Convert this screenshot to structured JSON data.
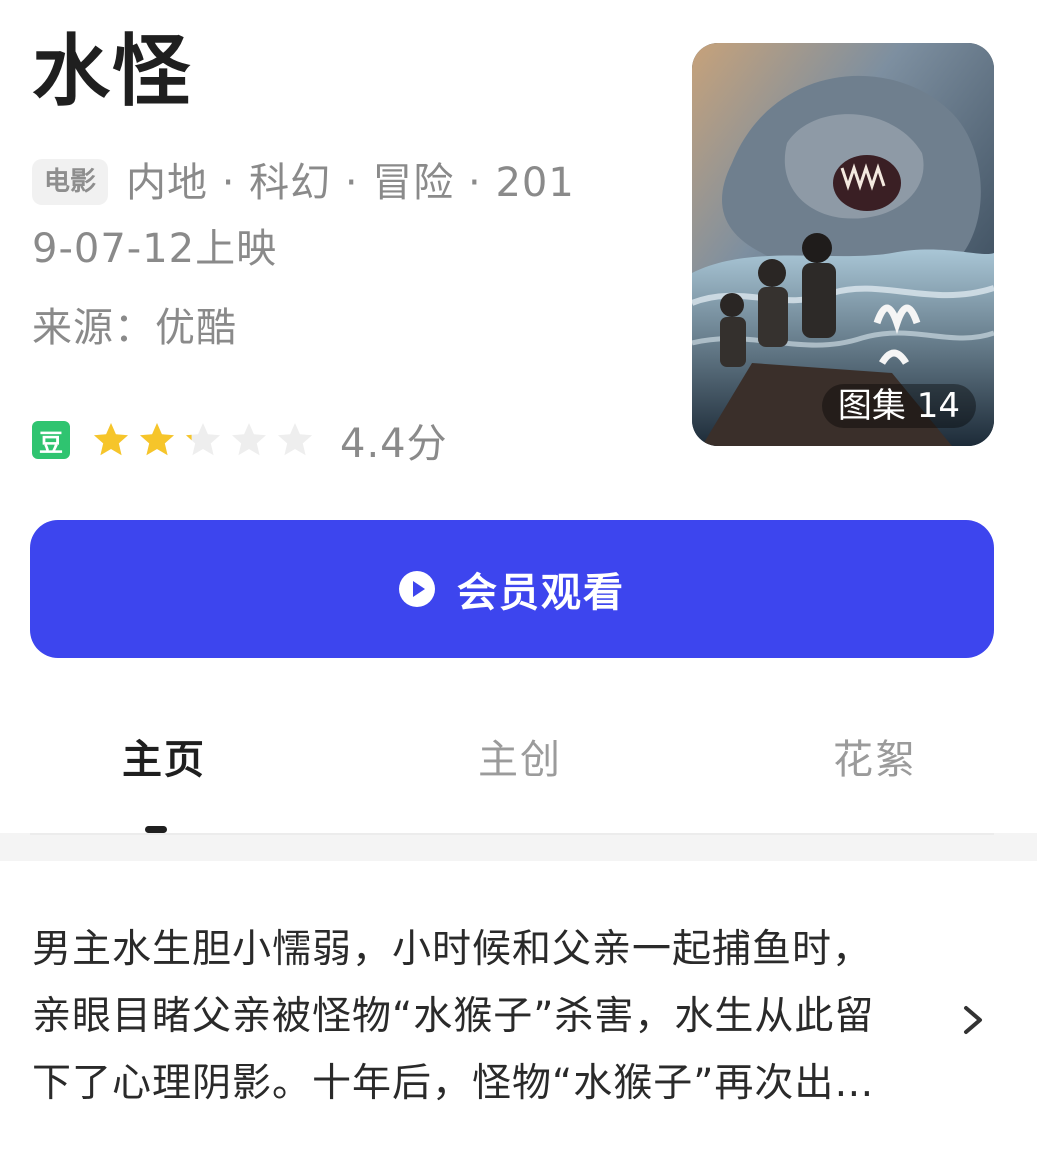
{
  "title": "水怪",
  "meta": {
    "type_badge": "电影",
    "line1": "内地 · 科幻 · 冒险 · 201",
    "line2": "9-07-12上映"
  },
  "source": "来源：优酷",
  "rating": {
    "platform_icon": "豆",
    "stars_total": 5,
    "stars_filled": 2.2,
    "score_text": "4.4分",
    "star_color": "#f6c52a",
    "star_empty_color": "#eeeeee",
    "platform_color": "#2fc470"
  },
  "poster": {
    "gallery_label": "图集 14",
    "icon": "poster-image"
  },
  "watch_button": {
    "label": "会员观看",
    "icon": "play-circle-icon",
    "color": "#3d45ee"
  },
  "tabs": [
    {
      "label": "主页",
      "active": true
    },
    {
      "label": "主创",
      "active": false
    },
    {
      "label": "花絮",
      "active": false
    }
  ],
  "synopsis": {
    "lines": [
      "男主水生胆小懦弱，小时候和父亲一起捕鱼时，",
      "亲眼目睹父亲被怪物“水猴子”杀害，水生从此留",
      "下了心理阴影。十年后，怪物“水猴子”再次出…"
    ],
    "expand_icon": "chevron-right-icon"
  }
}
